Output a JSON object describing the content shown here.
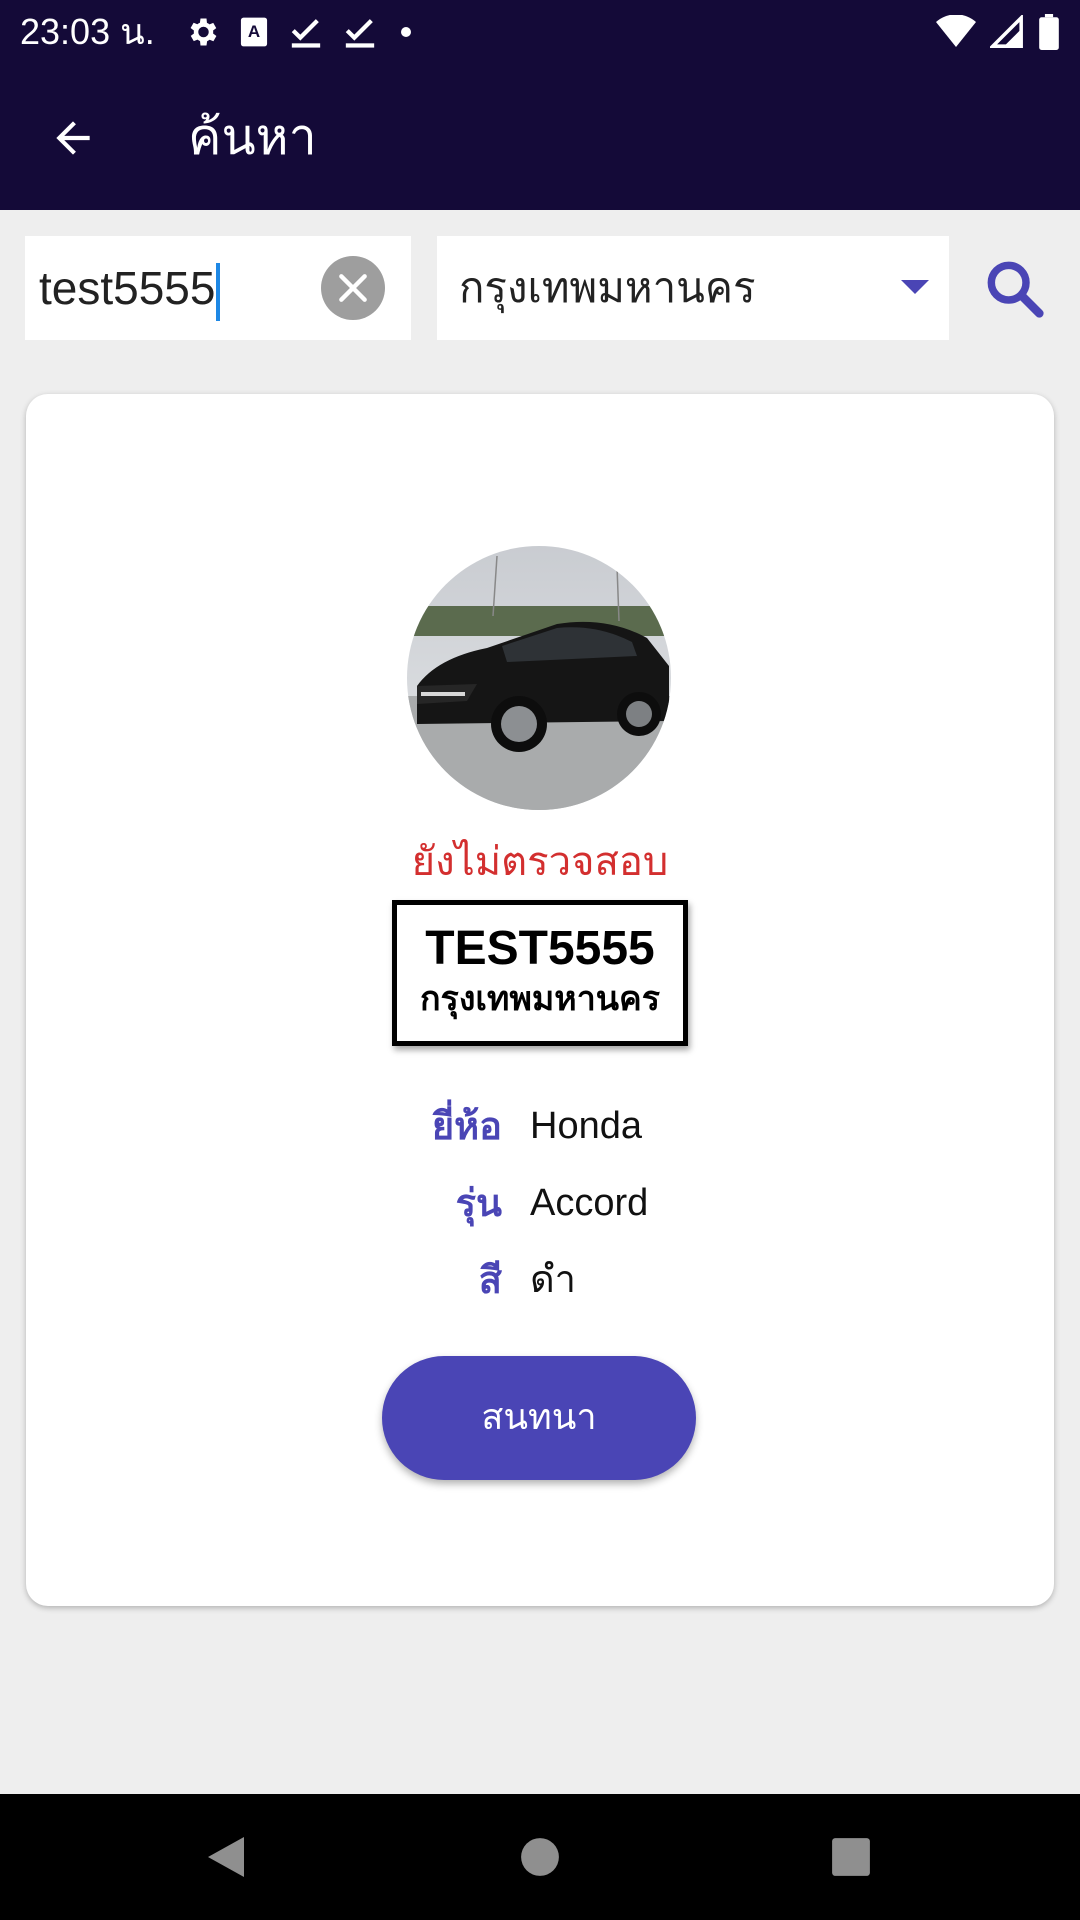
{
  "status_bar": {
    "time": "23:03 น.",
    "icons": [
      "settings-icon",
      "keyboard-a-icon",
      "check-download-icon",
      "check-download-icon",
      "dot-icon"
    ],
    "right_icons": [
      "wifi-icon",
      "signal-icon",
      "battery-icon"
    ]
  },
  "app_bar": {
    "title": "ค้นหา",
    "back_icon": "arrow-back-icon"
  },
  "search": {
    "plate_value": "test5555",
    "province_selected": "กรุงเทพมหานคร",
    "search_icon": "magnifier-icon"
  },
  "result": {
    "status": "ยังไม่ตรวจสอบ",
    "plate_number": "TEST5555",
    "plate_province": "กรุงเทพมหานคร",
    "details": [
      {
        "label": "ยี่ห้อ",
        "value": "Honda"
      },
      {
        "label": "รุ่น",
        "value": "Accord"
      },
      {
        "label": "สี",
        "value": "ดำ"
      }
    ],
    "chat_label": "สนทนา"
  },
  "colors": {
    "primary_dark": "#140a38",
    "accent": "#4a45b5",
    "status_red": "#d32f2f"
  }
}
